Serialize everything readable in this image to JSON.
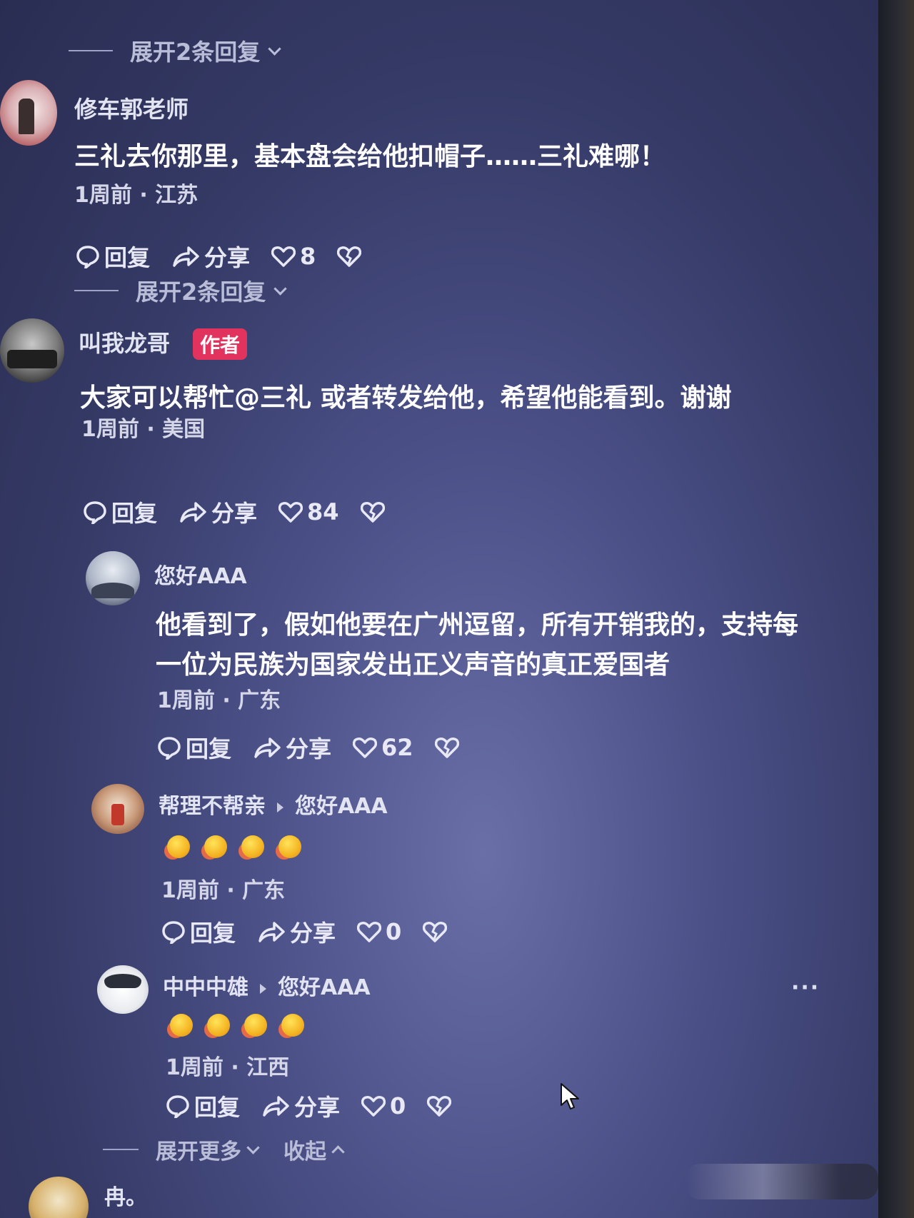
{
  "comments": [
    {
      "username": "修车郭老师",
      "content": "三礼去你那里，基本盘会给他扣帽子……三礼难哪！",
      "meta": "1周前 · 江苏",
      "likes": "8"
    },
    {
      "username": "叫我龙哥",
      "badge": "作者",
      "content": "大家可以帮忙@三礼 或者转发给他，希望他能看到。谢谢",
      "meta": "1周前 · 美国",
      "likes": "84"
    }
  ],
  "replies": [
    {
      "username": "您好AAA",
      "content_line1": "他看到了，假如他要在广州逗留，所有开销我的，支持每",
      "content_line2": "一位为民族为国家发出正义声音的真正爱国者",
      "meta": "1周前 · 广东",
      "likes": "62"
    },
    {
      "username": "帮理不帮亲",
      "reply_to": "您好AAA",
      "meta": "1周前 · 广东",
      "likes": "0"
    },
    {
      "username": "中中中雄",
      "reply_to": "您好AAA",
      "meta": "1周前 · 江西",
      "likes": "0"
    }
  ],
  "labels": {
    "expand_replies": "展开2条回复",
    "reply": "回复",
    "share": "分享",
    "expand_more": "展开更多",
    "collapse": "收起",
    "more_dots": "···"
  },
  "last_comment": {
    "username": "冉。"
  },
  "icons": [
    "comment-icon",
    "share-icon",
    "heart-icon",
    "dislike-heart-icon",
    "chevron-down-icon",
    "chevron-up-icon",
    "reply-arrow-icon",
    "thumbs-up-emoji",
    "mouse-cursor-icon"
  ],
  "colors": {
    "background": "#3d4278",
    "author_badge": "#e2335f",
    "text": "#ffffff"
  }
}
